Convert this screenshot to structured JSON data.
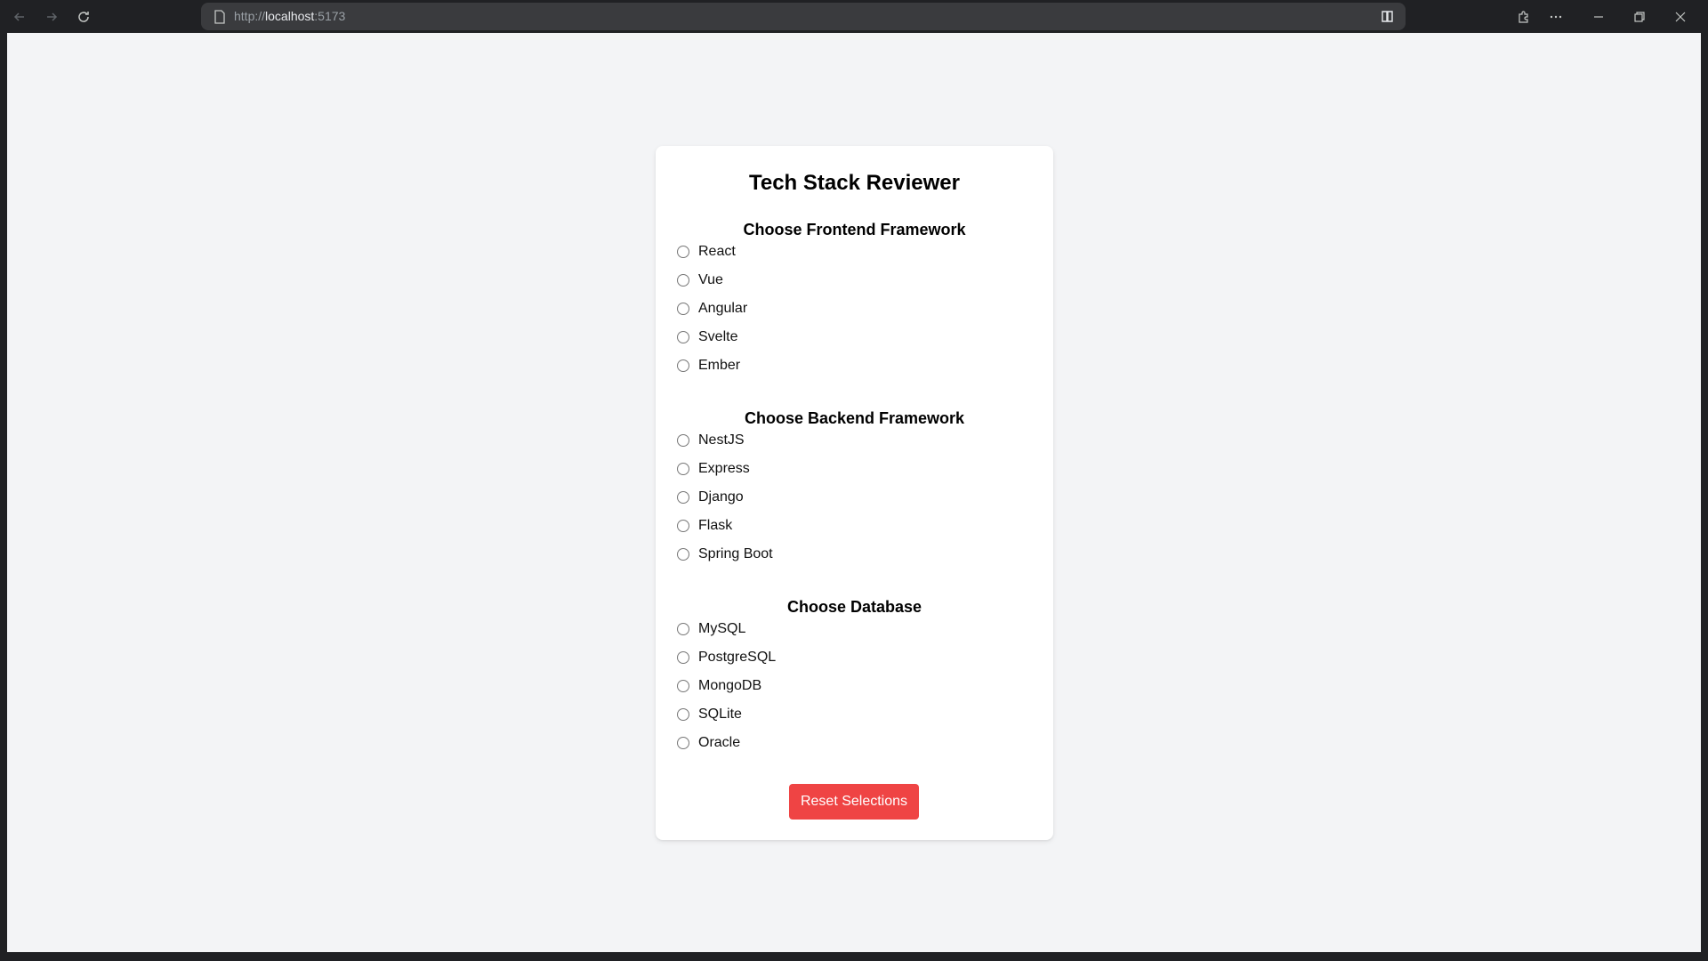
{
  "browser": {
    "url_scheme": "http://",
    "url_host": "localhost",
    "url_port": ":5173"
  },
  "card": {
    "title": "Tech Stack Reviewer",
    "sections": [
      {
        "heading": "Choose Frontend Framework",
        "options": [
          "React",
          "Vue",
          "Angular",
          "Svelte",
          "Ember"
        ]
      },
      {
        "heading": "Choose Backend Framework",
        "options": [
          "NestJS",
          "Express",
          "Django",
          "Flask",
          "Spring Boot"
        ]
      },
      {
        "heading": "Choose Database",
        "options": [
          "MySQL",
          "PostgreSQL",
          "MongoDB",
          "SQLite",
          "Oracle"
        ]
      }
    ],
    "reset_label": "Reset Selections"
  },
  "colors": {
    "accent_button": "#ef4444",
    "page_background": "#f3f4f6",
    "chrome_background": "#202124"
  }
}
